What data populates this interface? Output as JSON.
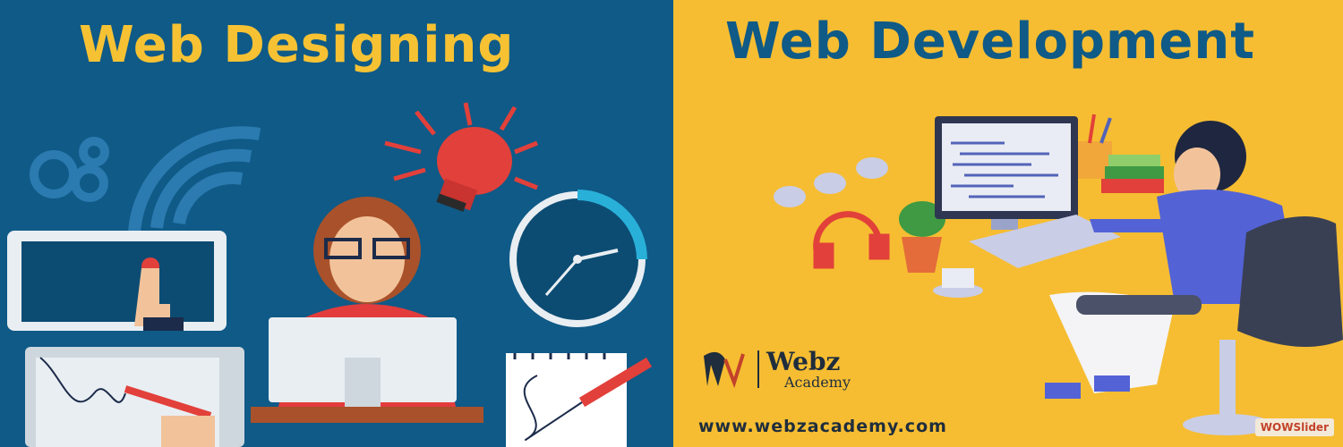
{
  "left_panel": {
    "title": "Web Designing",
    "bg_color": "#0f5a87",
    "title_color": "#f6c233"
  },
  "right_panel": {
    "title": "Web Development",
    "bg_color": "#f6bd32",
    "title_color": "#0f5a87",
    "logo": {
      "name": "Webz",
      "sub": "Academy"
    },
    "url": "www.webzacademy.com"
  },
  "slider_badge": "WOWSlider"
}
